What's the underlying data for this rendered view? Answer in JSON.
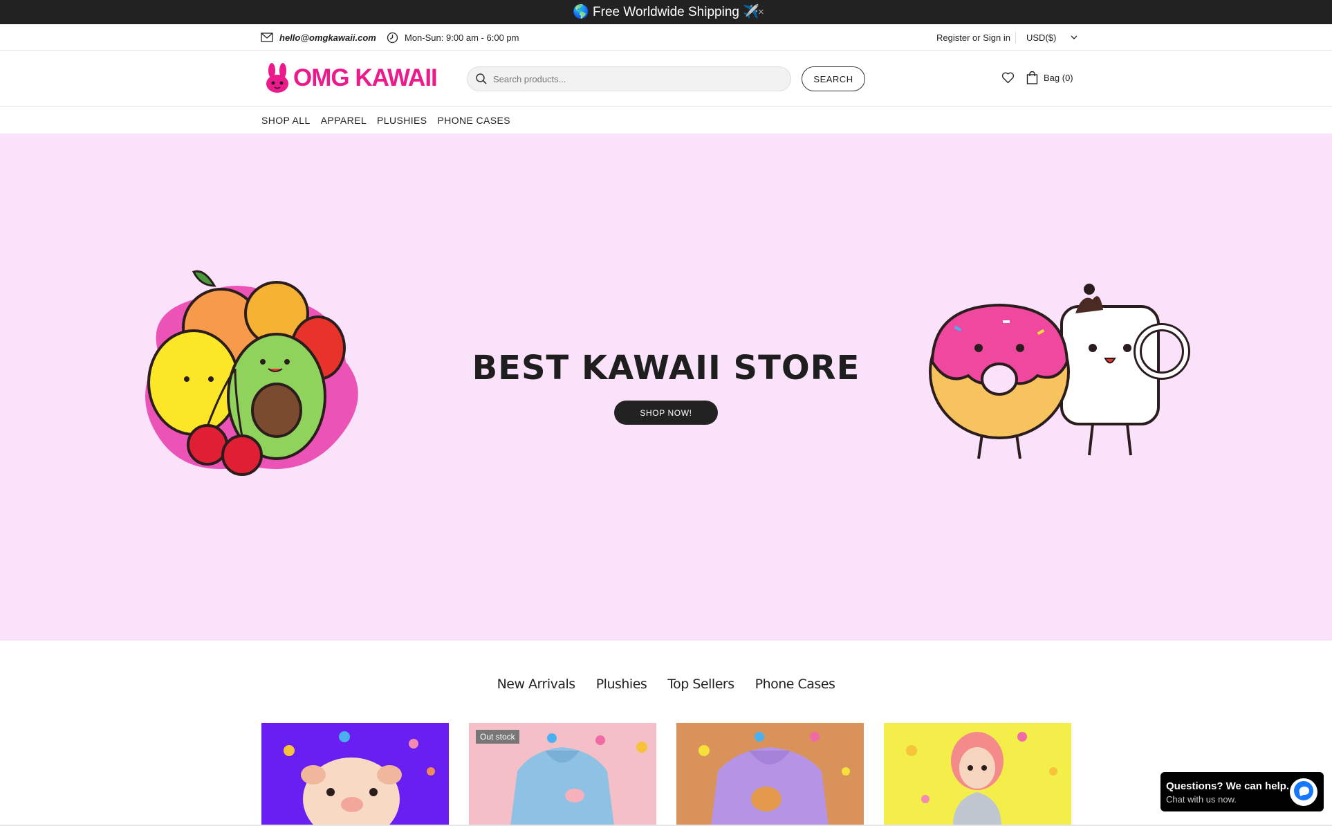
{
  "announcement": {
    "text": "🌎 Free Worldwide Shipping ✈️",
    "close": "×"
  },
  "topbar": {
    "email": "hello@omgkawaii.com",
    "hours": "Mon-Sun: 9:00 am - 6:00 pm",
    "register": "Register or Sign in",
    "currency": "USD($)"
  },
  "header": {
    "logo_text": "OMG KAWAII",
    "search_placeholder": "Search products...",
    "search_button": "SEARCH",
    "bag_label": "Bag (0)"
  },
  "nav": {
    "items": [
      "SHOP ALL",
      "APPAREL",
      "PLUSHIES",
      "PHONE CASES"
    ]
  },
  "hero": {
    "title": "BEST KAWAII STORE",
    "button": "SHOP NOW!",
    "background": "#fbe2fb"
  },
  "collections": {
    "tabs": [
      "New Arrivals",
      "Plushies",
      "Top Sellers",
      "Phone Cases"
    ]
  },
  "products": [
    {
      "badge": "",
      "bg": "#6a1ff2"
    },
    {
      "badge": "Out stock",
      "bg": "#f4bfc6"
    },
    {
      "badge": "",
      "bg": "#d9935a"
    },
    {
      "badge": "",
      "bg": "#f3ee4a"
    }
  ],
  "chat": {
    "question": "Questions? We can help.",
    "subtitle": "Chat with us now."
  },
  "colors": {
    "brand": "#ec1a8a",
    "dark": "#222222"
  }
}
